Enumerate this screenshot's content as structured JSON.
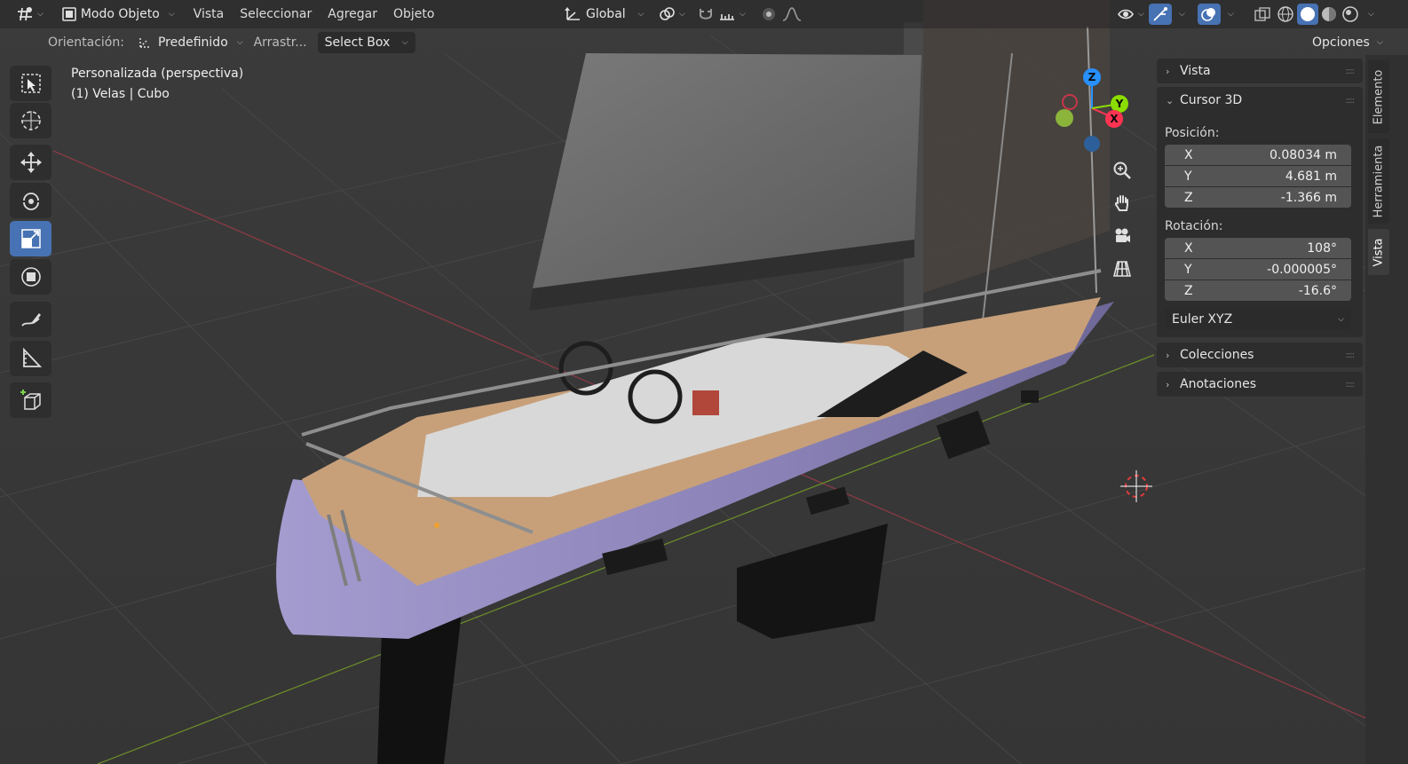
{
  "header": {
    "mode_label": "Modo Objeto",
    "menus": [
      "Vista",
      "Seleccionar",
      "Agregar",
      "Objeto"
    ],
    "transform_orientation": "Global",
    "options_label": "Opciones"
  },
  "tool_settings": {
    "orientation_label": "Orientación:",
    "orientation_value": "Predefinido",
    "drag_label": "Arrastr...",
    "drag_value": "Select Box"
  },
  "viewport": {
    "view_name": "Personalizada (perspectiva)",
    "object_info": "(1) Velas | Cubo",
    "gizmo_axes": [
      "X",
      "Y",
      "Z"
    ]
  },
  "left_tools": [
    {
      "name": "select-box-tool",
      "icon": "select-box-icon"
    },
    {
      "name": "cursor-tool",
      "icon": "cursor-icon"
    },
    {
      "name": "move-tool",
      "icon": "move-icon"
    },
    {
      "name": "rotate-tool",
      "icon": "rotate-icon"
    },
    {
      "name": "scale-tool",
      "icon": "scale-icon",
      "active": true
    },
    {
      "name": "transform-tool",
      "icon": "transform-icon"
    },
    {
      "name": "annotate-tool",
      "icon": "annotate-icon"
    },
    {
      "name": "measure-tool",
      "icon": "measure-icon"
    },
    {
      "name": "add-cube-tool",
      "icon": "add-cube-icon"
    }
  ],
  "sidebar": {
    "sections": {
      "vista": "Vista",
      "cursor3d": "Cursor 3D",
      "colecciones": "Colecciones",
      "anotaciones": "Anotaciones"
    },
    "position_label": "Posición:",
    "position": [
      {
        "axis": "X",
        "value": "0.08034 m"
      },
      {
        "axis": "Y",
        "value": "4.681 m"
      },
      {
        "axis": "Z",
        "value": "-1.366 m"
      }
    ],
    "rotation_label": "Rotación:",
    "rotation": [
      {
        "axis": "X",
        "value": "108°"
      },
      {
        "axis": "Y",
        "value": "-0.000005°"
      },
      {
        "axis": "Z",
        "value": "-16.6°"
      }
    ],
    "rotation_mode": "Euler XYZ",
    "tabs": [
      "Elemento",
      "Herramienta",
      "Vista"
    ],
    "active_tab": "Vista"
  },
  "colors": {
    "accent": "#4772b3",
    "axis_x": "#ff3352",
    "axis_y": "#8bdc00",
    "axis_z": "#2890ff",
    "hull": "#8c84b8",
    "deck": "#c9a27a"
  }
}
